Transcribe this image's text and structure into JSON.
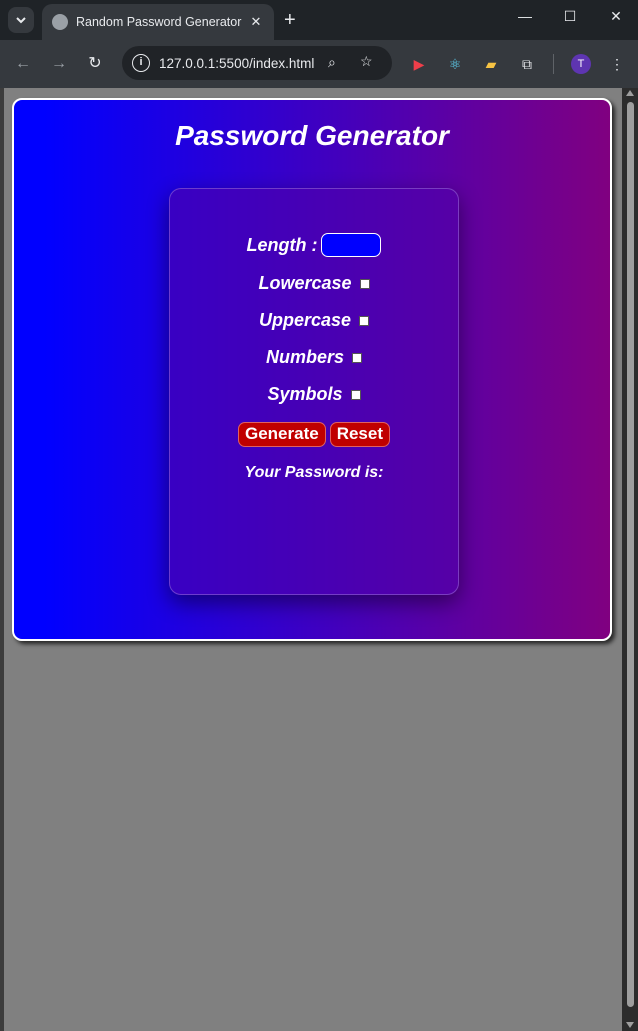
{
  "browser": {
    "tab_title": "Random Password Generator",
    "tab_close": "✕",
    "new_tab": "+",
    "url": "127.0.0.1:5500/index.html",
    "avatar_initial": "T"
  },
  "page": {
    "heading": "Password Generator",
    "length_label": "Length :",
    "length_value": "",
    "options": [
      {
        "label": "Lowercase",
        "checked": false
      },
      {
        "label": "Uppercase",
        "checked": false
      },
      {
        "label": "Numbers",
        "checked": false
      },
      {
        "label": "Symbols",
        "checked": false
      }
    ],
    "generate_label": "Generate",
    "reset_label": "Reset",
    "result_label": "Your Password is:",
    "result_value": ""
  },
  "colors": {
    "gradient_start": "#0000ff",
    "gradient_end": "#800080",
    "button_bg": "#c00000",
    "page_bg": "#808080"
  }
}
